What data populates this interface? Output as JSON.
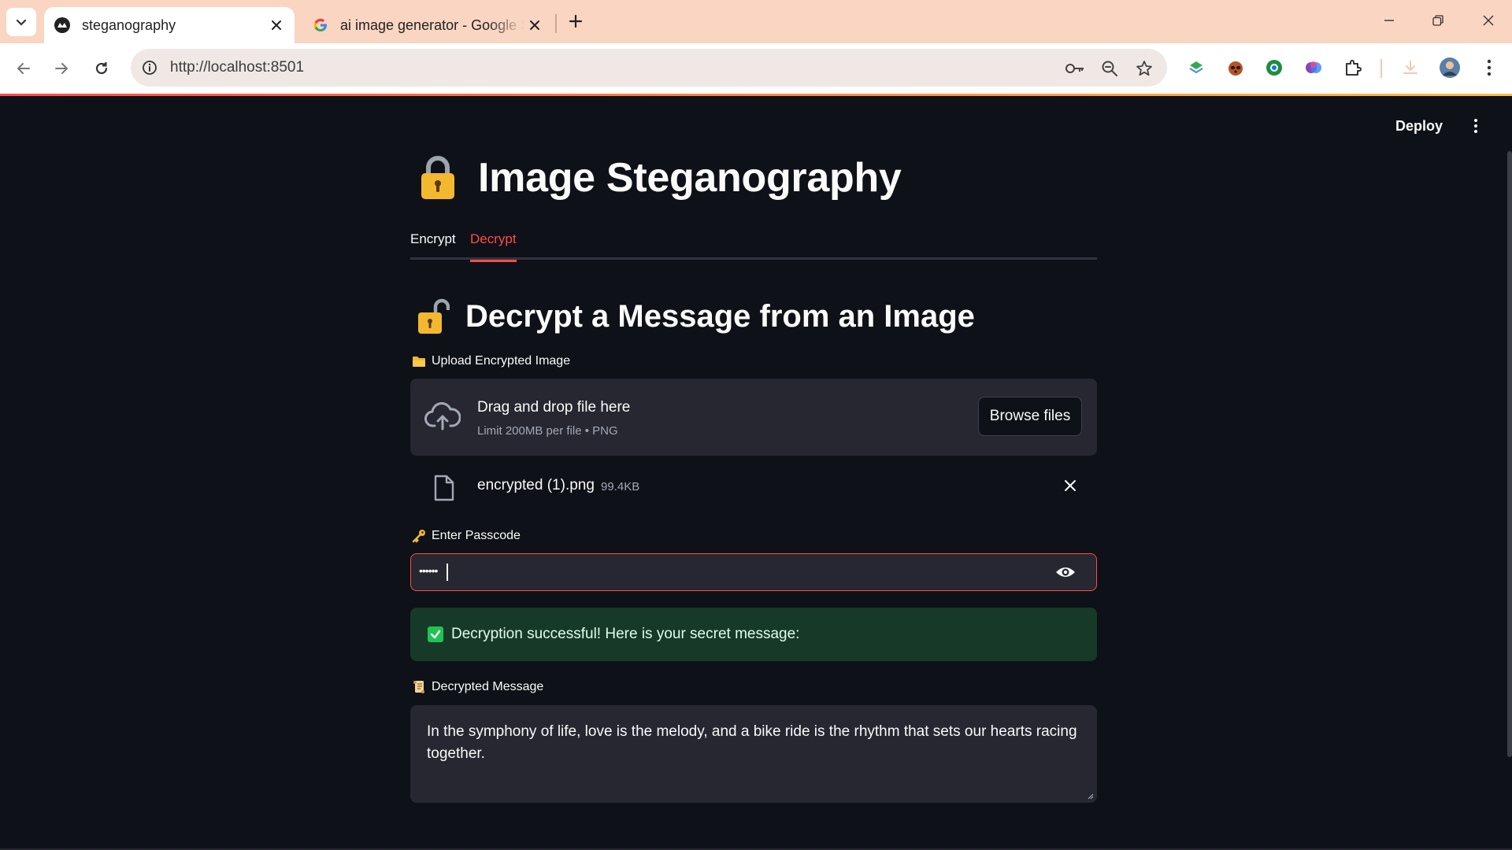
{
  "browser": {
    "tabs": [
      {
        "title": "steganography",
        "active": true
      },
      {
        "title": "ai image generator - Google Se",
        "active": false
      }
    ],
    "url": "http://localhost:8501"
  },
  "header": {
    "deploy_label": "Deploy"
  },
  "page": {
    "title": "Image Steganography",
    "tabs": [
      {
        "label": "Encrypt",
        "selected": false
      },
      {
        "label": "Decrypt",
        "selected": true
      }
    ],
    "subtitle": "Decrypt a Message from an Image"
  },
  "upload": {
    "label": "Upload Encrypted Image",
    "drop_title": "Drag and drop file here",
    "drop_hint": "Limit 200MB per file • PNG",
    "browse_label": "Browse files",
    "file": {
      "name": "encrypted (1).png",
      "size": "99.4KB"
    }
  },
  "passcode": {
    "label": "Enter Passcode",
    "masked_value": "••••••"
  },
  "alert": {
    "text": "Decryption successful! Here is your secret message:"
  },
  "decrypted": {
    "label": "Decrypted Message",
    "message": "In the symphony of life, love is the melody, and a bike ride is the rhythm that sets our hearts racing together."
  },
  "colors": {
    "accent": "#ff4b4b",
    "background": "#0e1117",
    "widget_bg": "#262730",
    "success_bg": "#173928",
    "success_check": "#21c354",
    "lock_gold": "#f4b730",
    "chrome_tabstrip": "#fad5c2"
  },
  "icons": {
    "title": "lock-icon",
    "subtitle": "open-lock-icon",
    "upload_label": "folder-icon",
    "passcode_label": "key-icon",
    "decrypted_label": "scroll-icon"
  }
}
